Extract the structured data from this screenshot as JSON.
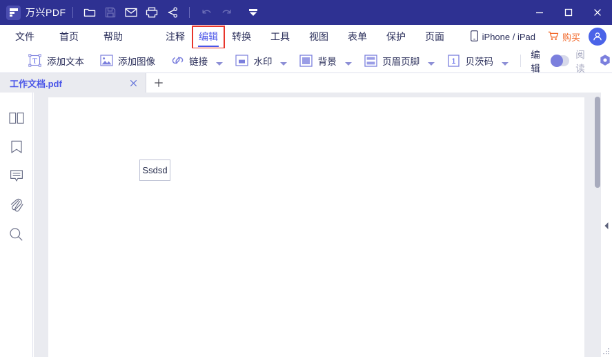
{
  "titlebar": {
    "brand": "万兴PDF",
    "icons": [
      {
        "name": "open-folder-icon",
        "label": "打开"
      },
      {
        "name": "save-icon",
        "label": "保存"
      },
      {
        "name": "email-icon",
        "label": "邮件"
      },
      {
        "name": "print-icon",
        "label": "打印"
      },
      {
        "name": "share-icon",
        "label": "分享"
      },
      {
        "name": "undo-icon",
        "label": "撤销"
      },
      {
        "name": "redo-icon",
        "label": "重做"
      },
      {
        "name": "more-dropdown-icon",
        "label": "更多"
      }
    ],
    "window_controls": [
      {
        "name": "minimize-button",
        "label": "—"
      },
      {
        "name": "maximize-button",
        "label": "□"
      },
      {
        "name": "close-button",
        "label": "✕"
      }
    ]
  },
  "menubar": {
    "left_items": [
      {
        "label": "文件",
        "name": "menu-file"
      },
      {
        "label": "首页",
        "name": "menu-home"
      },
      {
        "label": "帮助",
        "name": "menu-help"
      }
    ],
    "center_items": [
      {
        "label": "注释",
        "name": "menu-comment",
        "active": false
      },
      {
        "label": "编辑",
        "name": "menu-edit",
        "active": true,
        "highlighted": true
      },
      {
        "label": "转换",
        "name": "menu-convert",
        "active": false
      },
      {
        "label": "工具",
        "name": "menu-tool",
        "active": false
      },
      {
        "label": "视图",
        "name": "menu-view",
        "active": false
      },
      {
        "label": "表单",
        "name": "menu-form",
        "active": false
      },
      {
        "label": "保护",
        "name": "menu-protect",
        "active": false
      },
      {
        "label": "页面",
        "name": "menu-page",
        "active": false
      }
    ],
    "device_label": "iPhone / iPad",
    "buy_label": "购买",
    "accent_active": "#4a55e8",
    "accent_buy": "#f2682a",
    "highlight_box_color": "#e8352a"
  },
  "toolbar": {
    "items": [
      {
        "label": "添加文本",
        "icon": "add-text-icon",
        "dropdown": false
      },
      {
        "label": "添加图像",
        "icon": "add-image-icon",
        "dropdown": false
      },
      {
        "label": "链接",
        "icon": "link-icon",
        "dropdown": true
      },
      {
        "label": "水印",
        "icon": "watermark-icon",
        "dropdown": true
      },
      {
        "label": "背景",
        "icon": "background-icon",
        "dropdown": true
      },
      {
        "label": "页眉页脚",
        "icon": "header-footer-icon",
        "dropdown": true
      },
      {
        "label": "贝茨码",
        "icon": "bates-number-icon",
        "dropdown": true
      }
    ],
    "mode_edit_label": "编辑",
    "mode_read_label": "阅读",
    "mode_selected": "编辑",
    "hexagon_icon": "settings-hexagon-icon"
  },
  "tabs": {
    "documents": [
      {
        "title": "工作文档.pdf",
        "close": "✕"
      }
    ],
    "new_tab_label": "+"
  },
  "sidebar": {
    "items": [
      {
        "name": "thumbnail-panel-icon",
        "label": "缩略图"
      },
      {
        "name": "bookmark-panel-icon",
        "label": "书签"
      },
      {
        "name": "comment-panel-icon",
        "label": "注释"
      },
      {
        "name": "attachment-panel-icon",
        "label": "附件"
      },
      {
        "name": "search-panel-icon",
        "label": "搜索"
      }
    ],
    "expand_arrow": "▶"
  },
  "document": {
    "page_background": "#ffffff",
    "canvas_background": "#eaebf0",
    "textbox_value": "Ssdsd",
    "textbox_border_color": "#bcc0d4"
  },
  "right_panel": {
    "collapse_arrow": "◀"
  }
}
